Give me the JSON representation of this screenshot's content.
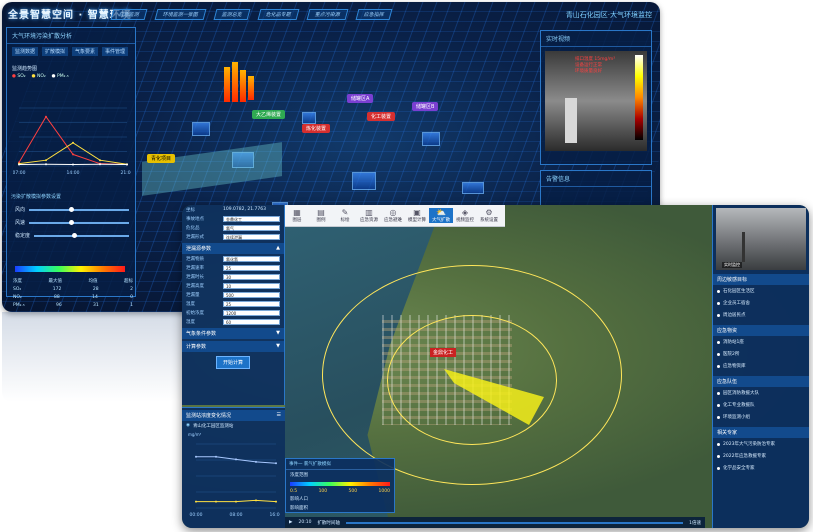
{
  "back": {
    "title": "全景智慧空间 · 智慧环境",
    "right_title": "青山石化园区·大气环境监控",
    "nav": [
      "应急监测",
      "环境监测一张图",
      "监测总览",
      "危化品专题",
      "重点污染源",
      "应急指挥"
    ],
    "left_panel": {
      "title": "大气环境污染扩散分析",
      "tabs": [
        "监测数据",
        "扩散模拟",
        "气象要素",
        "事件管理"
      ],
      "chart_title": "监测趋势图",
      "legend": [
        "SO₂",
        "NO₂",
        "PM₂.₅"
      ],
      "x_ticks": [
        "07:00",
        "14:00",
        "21:00"
      ],
      "section2": "污染扩散模拟参数设置",
      "sliders": [
        "风向",
        "风速",
        "稳定度"
      ],
      "table_rows": [
        [
          "浓度",
          "最大值",
          "均值",
          "超标"
        ],
        [
          "SO₂",
          "172",
          "28",
          "2"
        ],
        [
          "NO₂",
          "88",
          "14",
          "0"
        ],
        [
          "PM₂.₅",
          "96",
          "31",
          "1"
        ]
      ]
    },
    "right_panel": {
      "title": "实时视频",
      "title2": "告警信息",
      "items": [
        "排口温度 15mg/m³",
        "设备运行正常",
        "环境质量良好"
      ]
    },
    "map_tags": [
      {
        "text": "青化项目",
        "cls": "tag-yellow"
      },
      {
        "text": "大乙烯装置",
        "cls": "tag-green"
      },
      {
        "text": "炼化装置",
        "cls": "tag-red"
      },
      {
        "text": "储罐区A",
        "cls": "tag-purple"
      },
      {
        "text": "储罐区B",
        "cls": "tag-purple"
      },
      {
        "text": "化工装置",
        "cls": "tag-red"
      }
    ]
  },
  "front": {
    "toolbar": [
      {
        "icon": "▦",
        "label": "图层"
      },
      {
        "icon": "▤",
        "label": "图例"
      },
      {
        "icon": "✎",
        "label": "标绘"
      },
      {
        "icon": "▥",
        "label": "应急资源"
      },
      {
        "icon": "◎",
        "label": "应急避难"
      },
      {
        "icon": "▣",
        "label": "模型计算"
      },
      {
        "icon": "⛅",
        "label": "大气扩散"
      },
      {
        "icon": "◈",
        "label": "视频监控"
      },
      {
        "icon": "⚙",
        "label": "系统设置"
      }
    ],
    "active_tool_index": 6,
    "left_form": {
      "coords_label": "坐标",
      "coords_value": "109.0782, 21.7763",
      "rows": [
        {
          "label": "事故地点",
          "value": "金鼎化工"
        },
        {
          "label": "危化品",
          "value": "氯气"
        },
        {
          "label": "泄漏形式",
          "value": "连续泄漏"
        }
      ],
      "section_source": "泄漏源参数",
      "source_rows": [
        {
          "label": "泄漏物质",
          "value": "氯化氢"
        },
        {
          "label": "泄漏速率",
          "value": "25"
        },
        {
          "label": "泄漏时长",
          "value": "30"
        },
        {
          "label": "泄漏高度",
          "value": "10"
        },
        {
          "label": "泄漏量",
          "value": "500"
        },
        {
          "label": "温度",
          "value": "25"
        },
        {
          "label": "初始浓度",
          "value": "1200"
        },
        {
          "label": "湿度",
          "value": "60"
        }
      ],
      "section_weather": "气象条件参数",
      "section_calc": "计算参数",
      "calc_button": "开始计算"
    },
    "left_chart": {
      "title": "监测站浓度变化情况",
      "station": "青山化工园区监测站",
      "unit": "mg/m³",
      "x_ticks": [
        "00:00",
        "08:00",
        "16:00"
      ]
    },
    "info_box": {
      "title": "事件一 氯气扩散模拟",
      "rows": [
        "浓度范围",
        "影响人口",
        "影响面积"
      ],
      "values": [
        "0.5",
        "100",
        "500",
        "1000"
      ]
    },
    "bottom": {
      "time": "20:10",
      "label": "扩散时间轴",
      "speed": "1倍速"
    },
    "right": {
      "cam_caption": "实时监控",
      "sec1": "周边敏感目标",
      "items1": [
        "石化园区生活区",
        "企业员工宿舍",
        "周边居民点"
      ],
      "sec2": "应急物资",
      "items2": [
        "消防站1座",
        "医院2所",
        "应急物资库"
      ],
      "sec3": "应急队伍",
      "items3": [
        "园区消防救援大队",
        "化工专业救援队",
        "环境监测小组"
      ],
      "sec4": "相关专家",
      "items4": [
        "2023年大气污染防治专家",
        "2022年应急救援专家",
        "化学品安全专家"
      ]
    }
  },
  "chart_data": [
    {
      "type": "line",
      "x": [
        "07:00",
        "10:30",
        "14:00",
        "17:30",
        "21:00"
      ],
      "series": [
        {
          "name": "SO₂",
          "values": [
            12,
            170,
            40,
            8,
            5
          ]
        },
        {
          "name": "NO₂",
          "values": [
            8,
            20,
            80,
            20,
            6
          ]
        },
        {
          "name": "PM₂.₅",
          "values": [
            5,
            6,
            5,
            6,
            5
          ]
        }
      ],
      "ylim": [
        0,
        200
      ]
    },
    {
      "type": "line",
      "x": [
        "00:00",
        "04:00",
        "08:00",
        "12:00",
        "16:00"
      ],
      "series": [
        {
          "values": [
            40,
            40,
            38,
            36,
            35
          ]
        },
        {
          "values": [
            5,
            5,
            5,
            6,
            5
          ]
        }
      ],
      "ylim": [
        0,
        50
      ]
    }
  ]
}
